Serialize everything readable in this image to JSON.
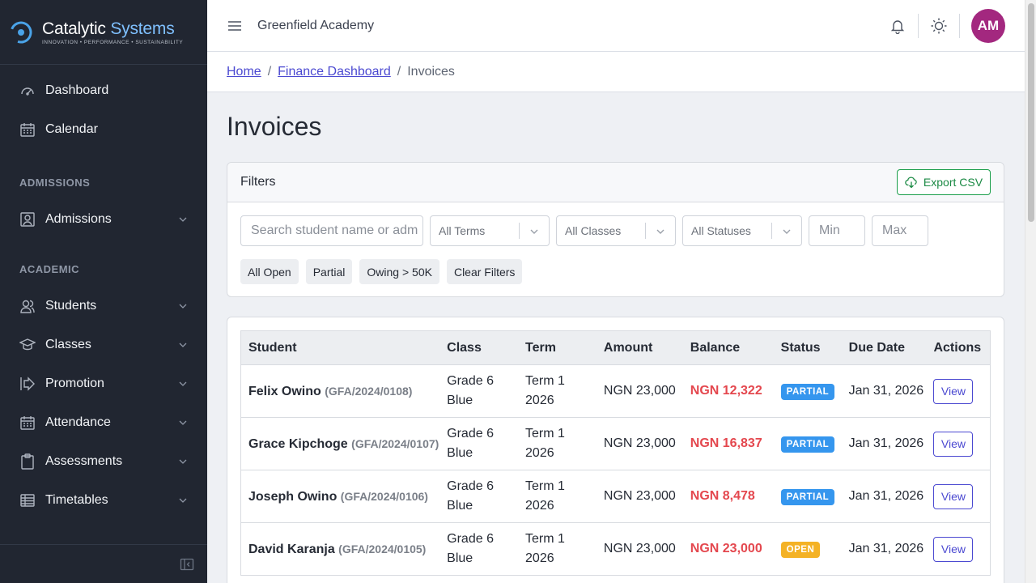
{
  "brand": {
    "name_part1": "Catalytic",
    "name_part2": "Systems",
    "tagline": "INNOVATION • PERFORMANCE • SUSTAINABILITY"
  },
  "sidebar": {
    "items_top": [
      {
        "label": "Dashboard",
        "icon": "speedometer-icon"
      },
      {
        "label": "Calendar",
        "icon": "calendar-icon"
      }
    ],
    "section_admissions": "ADMISSIONS",
    "admissions": [
      {
        "label": "Admissions",
        "icon": "user-frame-icon"
      }
    ],
    "section_academic": "ACADEMIC",
    "academic": [
      {
        "label": "Students",
        "icon": "people-icon"
      },
      {
        "label": "Classes",
        "icon": "graduation-cap-icon"
      },
      {
        "label": "Promotion",
        "icon": "arrow-enter-icon"
      },
      {
        "label": "Attendance",
        "icon": "calendar-check-icon"
      },
      {
        "label": "Assessments",
        "icon": "clipboard-icon"
      },
      {
        "label": "Timetables",
        "icon": "table-icon"
      }
    ]
  },
  "header": {
    "school_name": "Greenfield Academy",
    "avatar_initials": "AM"
  },
  "breadcrumb": {
    "home": "Home",
    "finance": "Finance Dashboard",
    "current": "Invoices",
    "separator": "/"
  },
  "page": {
    "title": "Invoices"
  },
  "filters": {
    "title": "Filters",
    "export_label": "Export CSV",
    "search_placeholder": "Search student name or adm",
    "terms_selected": "All Terms",
    "classes_selected": "All Classes",
    "statuses_selected": "All Statuses",
    "min_placeholder": "Min",
    "max_placeholder": "Max",
    "chips": [
      "All Open",
      "Partial",
      "Owing > 50K",
      "Clear Filters"
    ]
  },
  "table": {
    "columns": [
      "Student",
      "Class",
      "Term",
      "Amount",
      "Balance",
      "Status",
      "Due Date",
      "Actions"
    ],
    "rows": [
      {
        "name": "Felix Owino",
        "id": "(GFA/2024/0108)",
        "class": "Grade 6 Blue",
        "term": "Term 1 2026",
        "amount": "NGN 23,000",
        "balance": "NGN 12,322",
        "status": "PARTIAL",
        "due": "Jan 31, 2026",
        "action": "View"
      },
      {
        "name": "Grace Kipchoge",
        "id": "(GFA/2024/0107)",
        "class": "Grade 6 Blue",
        "term": "Term 1 2026",
        "amount": "NGN 23,000",
        "balance": "NGN 16,837",
        "status": "PARTIAL",
        "due": "Jan 31, 2026",
        "action": "View"
      },
      {
        "name": "Joseph Owino",
        "id": "(GFA/2024/0106)",
        "class": "Grade 6 Blue",
        "term": "Term 1 2026",
        "amount": "NGN 23,000",
        "balance": "NGN 8,478",
        "status": "PARTIAL",
        "due": "Jan 31, 2026",
        "action": "View"
      },
      {
        "name": "David Karanja",
        "id": "(GFA/2024/0105)",
        "class": "Grade 6 Blue",
        "term": "Term 1 2026",
        "amount": "NGN 23,000",
        "balance": "NGN 23,000",
        "status": "OPEN",
        "due": "Jan 31, 2026",
        "action": "View"
      }
    ]
  },
  "colors": {
    "sidebar_bg": "#212631",
    "accent": "#4b49d1",
    "balance": "#e4474e",
    "partial": "#3596ee",
    "open": "#f4b225",
    "export": "#1b9e4a",
    "avatar": "#a3287f"
  }
}
